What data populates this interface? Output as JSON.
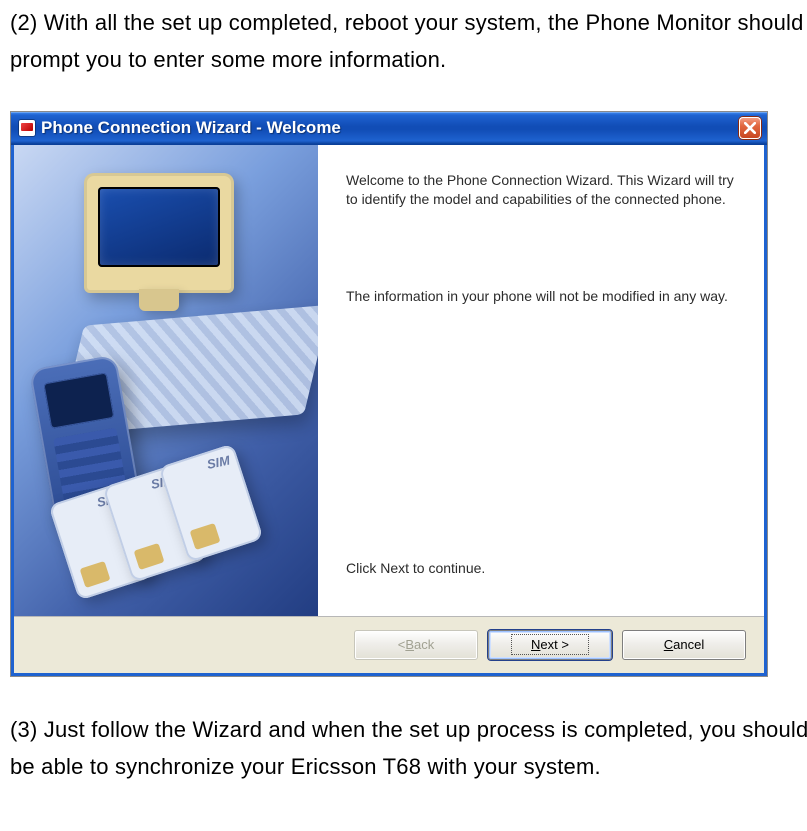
{
  "doc": {
    "para_top": "(2) With all the set up completed, reboot your system, the Phone Monitor should prompt you to enter some more information.",
    "para_bottom": "(3) Just follow the Wizard and when the set up process is completed, you should be able to synchronize your Ericsson T68 with your system."
  },
  "dialog": {
    "title": "Phone Connection Wizard - Welcome",
    "body": {
      "welcome": "Welcome to the Phone Connection Wizard. This Wizard will try to identify the model and capabilities of the connected phone.",
      "not_modified": "The information in your phone will not be modified in any way.",
      "click_next": "Click Next to continue."
    },
    "buttons": {
      "back_prefix": "< ",
      "back_mn": "B",
      "back_suffix": "ack",
      "next_mn": "N",
      "next_suffix": "ext >",
      "cancel_mn": "C",
      "cancel_suffix": "ancel"
    }
  }
}
